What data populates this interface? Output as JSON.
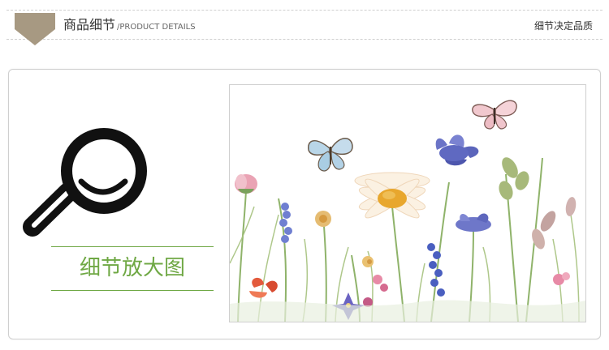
{
  "header": {
    "title_cn": "商品细节",
    "title_en": "/PRODUCT DETAILS",
    "slogan": "细节决定品质",
    "banner_color": "#a79982"
  },
  "detail": {
    "title": "细节放大图",
    "accent_color": "#6fa844"
  },
  "icons": {
    "magnifier": "magnifier-smile-icon",
    "banner": "ribbon-banner-icon"
  },
  "photo": {
    "subject": "watercolor-wildflowers-with-butterflies"
  }
}
